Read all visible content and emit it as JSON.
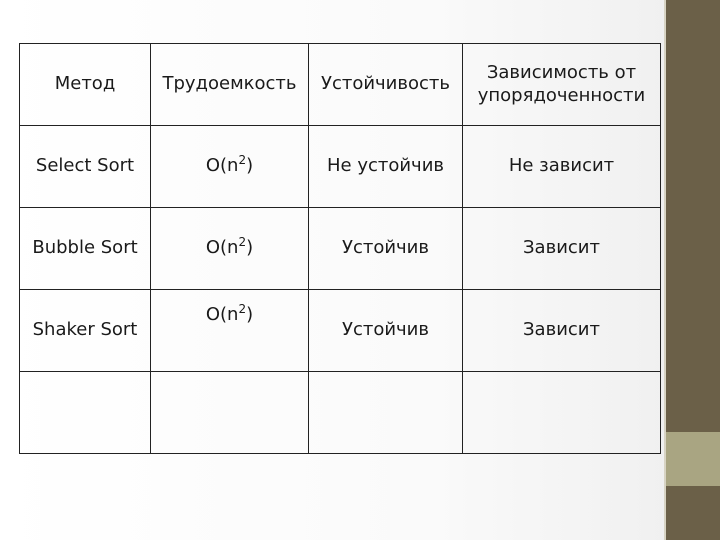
{
  "table": {
    "headers": [
      "Метод",
      "Трудоемкость",
      "Устойчивость",
      "Зависимость от упорядоченности"
    ],
    "rows": [
      {
        "method": "Select Sort",
        "complexity_base": "O(n",
        "complexity_exp": "2",
        "complexity_close": ")",
        "stability": "Не устойчив",
        "order_dependence": "Не зависит"
      },
      {
        "method": "Bubble Sort",
        "complexity_base": "O(n",
        "complexity_exp": "2",
        "complexity_close": ")",
        "stability": "Устойчив",
        "order_dependence": "Зависит"
      },
      {
        "method": "Shaker Sort",
        "complexity_base": "O(n",
        "complexity_exp": "2",
        "complexity_close": ")",
        "stability": "Устойчив",
        "order_dependence": "Зависит"
      },
      {
        "method": "",
        "complexity_base": "",
        "complexity_exp": "",
        "complexity_close": "",
        "stability": "",
        "order_dependence": ""
      }
    ]
  },
  "colors": {
    "side_strip": "#6b6048",
    "side_strip_accent": "#a9a582"
  }
}
